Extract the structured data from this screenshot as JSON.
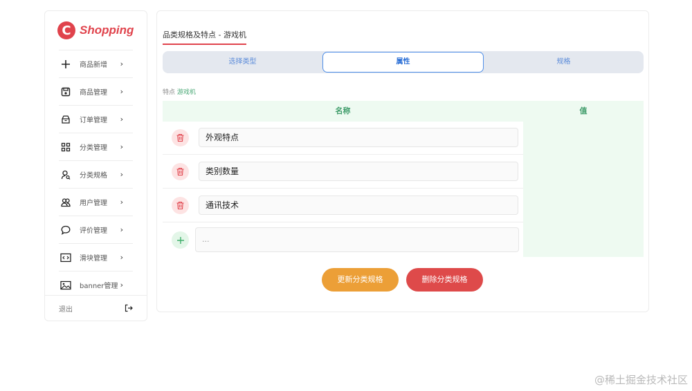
{
  "brand": {
    "logo_letter": "C",
    "name": "Shopping",
    "accent": "#e0434c"
  },
  "sidebar": {
    "items": [
      {
        "label": "商品新增",
        "icon": "plus-icon"
      },
      {
        "label": "商品管理",
        "icon": "save-icon"
      },
      {
        "label": "订单管理",
        "icon": "package-icon"
      },
      {
        "label": "分类管理",
        "icon": "grid-icon"
      },
      {
        "label": "分类规格",
        "icon": "user-search-icon"
      },
      {
        "label": "用户管理",
        "icon": "users-icon"
      },
      {
        "label": "评价管理",
        "icon": "chat-icon"
      },
      {
        "label": "滑块管理",
        "icon": "code-icon"
      },
      {
        "label": "banner管理",
        "icon": "image-icon"
      }
    ],
    "logout_label": "退出"
  },
  "main": {
    "title": "品类规格及特点 - 游戏机",
    "tabs": [
      {
        "label": "选择类型",
        "active": false
      },
      {
        "label": "属性",
        "active": true
      },
      {
        "label": "规格",
        "active": false
      }
    ],
    "crumb_prefix": "特点",
    "crumb_value": "游戏机",
    "table": {
      "col_name": "名称",
      "col_value": "值",
      "rows": [
        "外观特点",
        "类别数量",
        "通讯技术"
      ],
      "add_placeholder": "..."
    },
    "update_button": "更新分类规格",
    "delete_button": "删除分类规格"
  },
  "watermark": "@稀土掘金技术社区"
}
